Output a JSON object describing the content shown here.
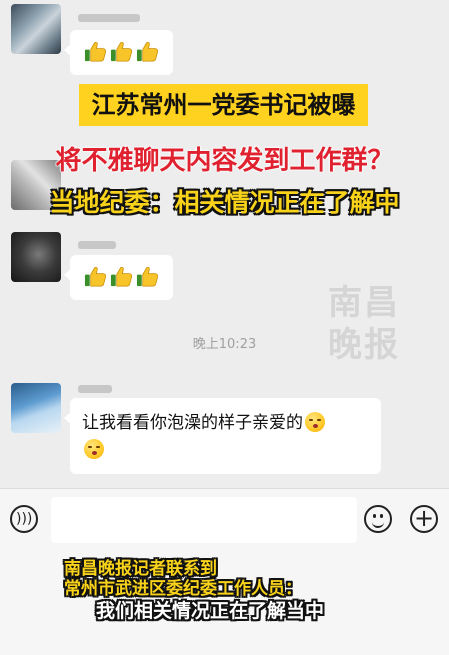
{
  "messages": [
    {
      "sender_blurred": true,
      "content": "thumbs-up x3"
    },
    {
      "sender_blurred": true,
      "content": "thumbs-up x3"
    },
    {
      "sender_blurred": true,
      "text": "让我看看你泡澡的样子亲爱的",
      "emoji": "kissing-face-icon"
    }
  ],
  "timestamp": "晚上10:23",
  "overlay": {
    "title": "江苏常州一党委书记被曝",
    "subtitle1": "将不雅聊天内容发到工作群？",
    "subtitle2": "当地纪委：相关情况正在了解中",
    "watermark_line1": "南昌",
    "watermark_line2": "晚报"
  },
  "caption": {
    "line1": "南昌晚报记者联系到",
    "line2": "常州市武进区委纪委工作人员：",
    "line3": "我们相关情况正在了解当中"
  },
  "input_bar": {
    "voice_icon": "voice-icon",
    "emoji_icon": "smiley-icon",
    "plus_icon": "plus-icon"
  },
  "colors": {
    "title_bg": "#ffd21f",
    "subtitle_red": "#e0212f",
    "subtitle_yellow": "#f9d31a",
    "chat_bg": "#ededed"
  }
}
